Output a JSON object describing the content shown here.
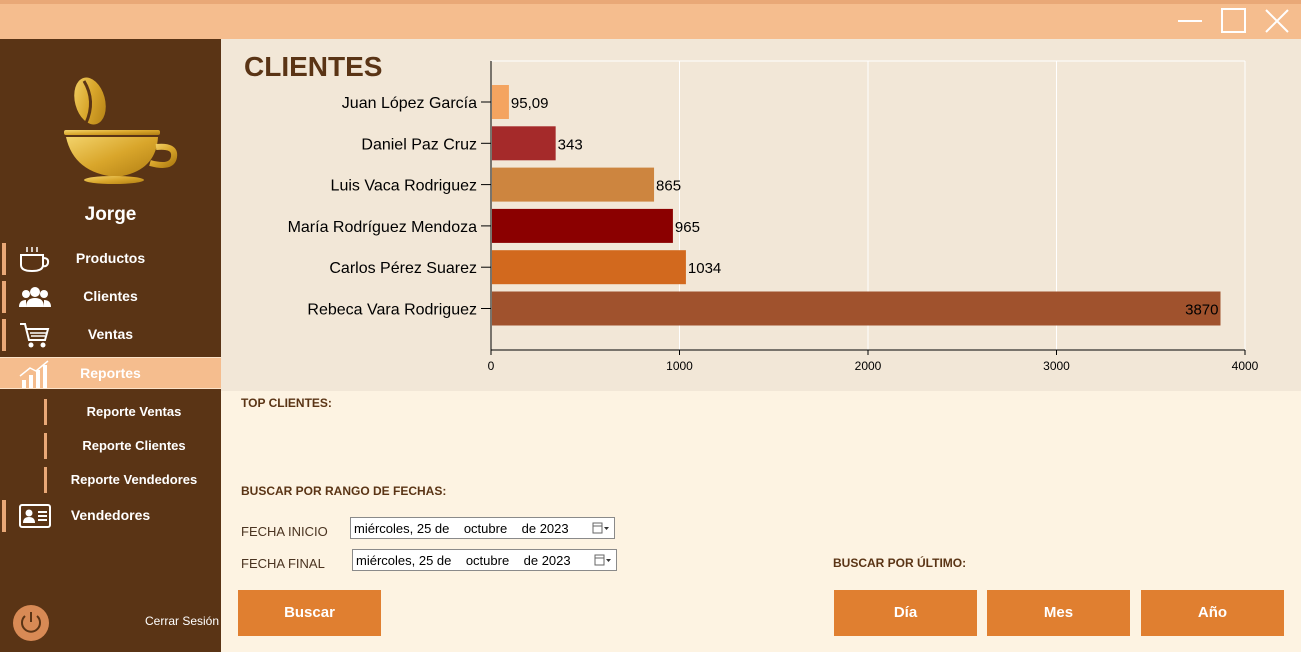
{
  "window": {
    "minimize_icon": "minimize-icon",
    "maximize_icon": "maximize-icon",
    "close_icon": "close-icon"
  },
  "sidebar": {
    "username": "Jorge",
    "items": [
      {
        "label": "Productos",
        "icon": "coffee-cup-icon"
      },
      {
        "label": "Clientes",
        "icon": "users-icon"
      },
      {
        "label": "Ventas",
        "icon": "shopping-cart-icon"
      },
      {
        "label": "Reportes",
        "icon": "bar-chart-icon"
      },
      {
        "label": "Vendedores",
        "icon": "id-card-icon"
      }
    ],
    "subitems": [
      {
        "label": "Reporte Ventas"
      },
      {
        "label": "Reporte Clientes"
      },
      {
        "label": "Reporte Vendedores"
      }
    ],
    "logout_label": "Cerrar Sesión"
  },
  "chart_data": {
    "type": "bar",
    "orientation": "horizontal",
    "title": "CLIENTES",
    "categories": [
      "Juan López García",
      "Daniel Paz Cruz",
      "Luis Vaca Rodriguez",
      "María Rodríguez Mendoza",
      "Carlos Pérez Suarez",
      "Rebeca Vara Rodriguez"
    ],
    "values": [
      95.09,
      343,
      865,
      965,
      1034,
      3870
    ],
    "value_labels": [
      "95,09",
      "343",
      "865",
      "965",
      "1034",
      "3870"
    ],
    "colors": [
      "#f4a460",
      "#a52a2a",
      "#cd853f",
      "#8b0000",
      "#d2691e",
      "#a0522d"
    ],
    "xlim": [
      0,
      4000
    ],
    "xticks": [
      "0",
      "1000",
      "2000",
      "3000",
      "4000"
    ],
    "grid": true
  },
  "report": {
    "top_clients_label": "TOP CLIENTES:",
    "date_range_label": "BUSCAR POR RANGO DE FECHAS:",
    "start_label": "FECHA INICIO",
    "end_label": "FECHA FINAL",
    "start_value": "miércoles, 25 de    octubre    de 2023",
    "end_value": "miércoles, 25 de    octubre    de 2023",
    "search_button": "Buscar",
    "last_label": "BUSCAR POR ÚLTIMO:",
    "day_button": "Día",
    "month_button": "Mes",
    "year_button": "Año"
  }
}
